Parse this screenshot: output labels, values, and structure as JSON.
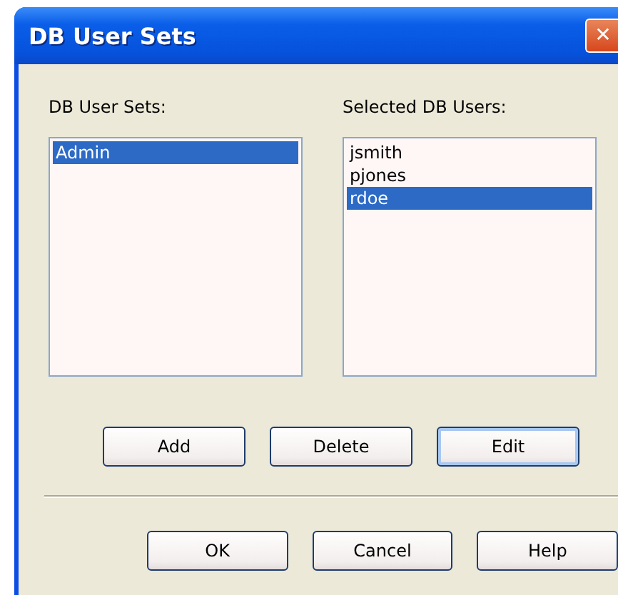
{
  "window": {
    "title": "DB User Sets",
    "close": "✕"
  },
  "lists": [
    {
      "label": "DB User Sets:",
      "items": [
        {
          "text": "Admin",
          "selected": true
        }
      ]
    },
    {
      "label": "Selected DB Users:",
      "items": [
        {
          "text": "jsmith",
          "selected": false
        },
        {
          "text": "pjones",
          "selected": false
        },
        {
          "text": "rdoe",
          "selected": true
        }
      ]
    }
  ],
  "actions": [
    {
      "label": "Add",
      "focused": false
    },
    {
      "label": "Delete",
      "focused": false
    },
    {
      "label": "Edit",
      "focused": true
    }
  ],
  "buttons": [
    {
      "label": "OK",
      "focused": false
    },
    {
      "label": "Cancel",
      "focused": false
    },
    {
      "label": "Help",
      "focused": false
    }
  ]
}
